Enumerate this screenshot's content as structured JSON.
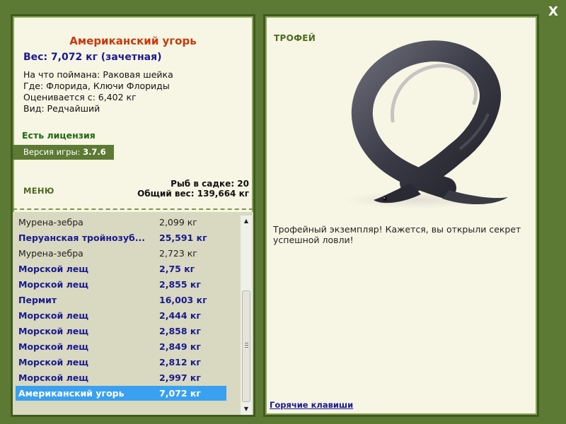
{
  "close_button": {
    "label": "X"
  },
  "details": {
    "title": "Американский угорь",
    "weight_line": "Вес: 7,072 кг (зачетная)",
    "info_lines": [
      "На что поймана: Раковая шейка",
      "Где: Флорида, Ключи Флориды",
      "Оценивается с: 6,402 кг",
      "Вид: Редчайший"
    ]
  },
  "license": {
    "text": "Есть лицензия"
  },
  "version": {
    "label": "Версия игры: ",
    "value": "3.7.6"
  },
  "menu": {
    "label": "МЕНЮ"
  },
  "keepnet": {
    "fish_count_line": "Рыб в садке: 20",
    "total_weight_line": "Общий вес: 139,664 кг"
  },
  "fish_list": [
    {
      "name": "Мурена-зебра",
      "weight": "2,099 кг",
      "trophy": false,
      "selected": false
    },
    {
      "name": "Перуанская тройнозуб...",
      "weight": "25,591 кг",
      "trophy": true,
      "selected": false
    },
    {
      "name": "Мурена-зебра",
      "weight": "2,723 кг",
      "trophy": false,
      "selected": false
    },
    {
      "name": "Морской лещ",
      "weight": "2,75 кг",
      "trophy": true,
      "selected": false
    },
    {
      "name": "Морской лещ",
      "weight": "2,855 кг",
      "trophy": true,
      "selected": false
    },
    {
      "name": "Пермит",
      "weight": "16,003 кг",
      "trophy": true,
      "selected": false
    },
    {
      "name": "Морской лещ",
      "weight": "2,444 кг",
      "trophy": true,
      "selected": false
    },
    {
      "name": "Морской лещ",
      "weight": "2,858 кг",
      "trophy": true,
      "selected": false
    },
    {
      "name": "Морской лещ",
      "weight": "2,849 кг",
      "trophy": true,
      "selected": false
    },
    {
      "name": "Морской лещ",
      "weight": "2,812 кг",
      "trophy": true,
      "selected": false
    },
    {
      "name": "Морской лещ",
      "weight": "2,997 кг",
      "trophy": true,
      "selected": false
    },
    {
      "name": "Американский угорь",
      "weight": "7,072 кг",
      "trophy": true,
      "selected": true
    }
  ],
  "trophy": {
    "label": "ТРОФЕЙ",
    "message": "Трофейный экземпляр! Кажется, вы открыли секрет успешной ловли!"
  },
  "hotkeys": {
    "label": "Горячие клавиши"
  },
  "colors": {
    "background": "#5d7a35",
    "panel": "#f7f5e4",
    "title": "#c8380a",
    "trophy_text": "#1a1a90",
    "license": "#1e6a10",
    "selection": "#3aa0f0"
  },
  "icons": {
    "close": "close-icon",
    "scroll_up": "chevron-up-icon",
    "scroll_down": "chevron-down-icon"
  }
}
